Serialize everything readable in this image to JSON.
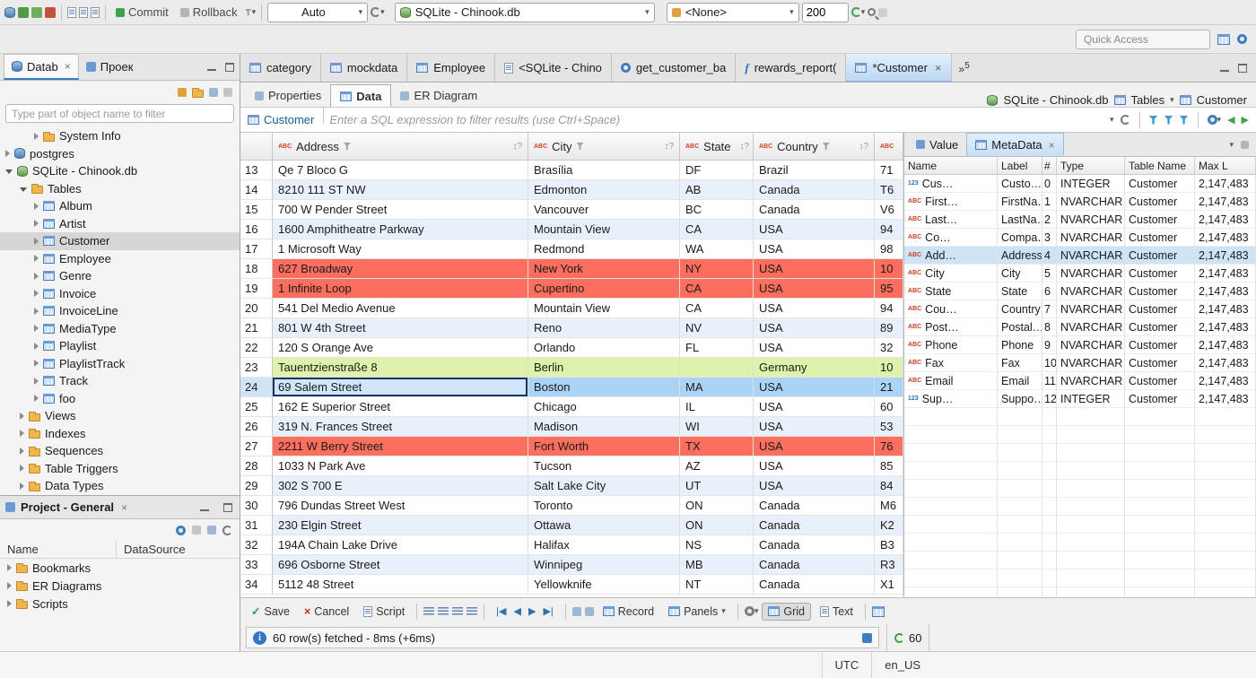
{
  "icons": {
    "close": "×",
    "caret": "▾",
    "overflow_chevrons": "»",
    "sort_hint": "↕?",
    "check": "✓",
    "cancel_x": "×",
    "info": "i",
    "nav_first": "|◀",
    "nav_prev": "◀",
    "nav_next": "▶",
    "nav_last": "▶|",
    "abc": "ABC",
    "num": "123"
  },
  "topbar": {
    "commit": "Commit",
    "rollback": "Rollback",
    "tx_mode": "Auto",
    "datasource": "SQLite - Chinook.db",
    "schema": "<None>",
    "fetch_size": "200",
    "quick_access": "Quick Access"
  },
  "navigator": {
    "tab_database": "Datab",
    "tab_project": "Проек",
    "filter_placeholder": "Type part of object name to filter",
    "tree": [
      {
        "label": "System Info",
        "indent": 2,
        "arrow": "right",
        "icon": "folder"
      },
      {
        "label": "postgres",
        "indent": 0,
        "arrow": "right",
        "icon": "db"
      },
      {
        "label": "SQLite - Chinook.db",
        "indent": 0,
        "arrow": "down",
        "icon": "db-green"
      },
      {
        "label": "Tables",
        "indent": 1,
        "arrow": "down",
        "icon": "folder"
      },
      {
        "label": "Album",
        "indent": 2,
        "arrow": "right",
        "icon": "table"
      },
      {
        "label": "Artist",
        "indent": 2,
        "arrow": "right",
        "icon": "table"
      },
      {
        "label": "Customer",
        "indent": 2,
        "arrow": "right",
        "icon": "table",
        "selected": true
      },
      {
        "label": "Employee",
        "indent": 2,
        "arrow": "right",
        "icon": "table"
      },
      {
        "label": "Genre",
        "indent": 2,
        "arrow": "right",
        "icon": "table"
      },
      {
        "label": "Invoice",
        "indent": 2,
        "arrow": "right",
        "icon": "table"
      },
      {
        "label": "InvoiceLine",
        "indent": 2,
        "arrow": "right",
        "icon": "table"
      },
      {
        "label": "MediaType",
        "indent": 2,
        "arrow": "right",
        "icon": "table"
      },
      {
        "label": "Playlist",
        "indent": 2,
        "arrow": "right",
        "icon": "table"
      },
      {
        "label": "PlaylistTrack",
        "indent": 2,
        "arrow": "right",
        "icon": "table"
      },
      {
        "label": "Track",
        "indent": 2,
        "arrow": "right",
        "icon": "table"
      },
      {
        "label": "foo",
        "indent": 2,
        "arrow": "right",
        "icon": "table"
      },
      {
        "label": "Views",
        "indent": 1,
        "arrow": "right",
        "icon": "folder"
      },
      {
        "label": "Indexes",
        "indent": 1,
        "arrow": "right",
        "icon": "folder"
      },
      {
        "label": "Sequences",
        "indent": 1,
        "arrow": "right",
        "icon": "folder"
      },
      {
        "label": "Table Triggers",
        "indent": 1,
        "arrow": "right",
        "icon": "folder"
      },
      {
        "label": "Data Types",
        "indent": 1,
        "arrow": "right",
        "icon": "folder"
      }
    ]
  },
  "project_panel": {
    "title": "Project - General",
    "col_name": "Name",
    "col_datasource": "DataSource",
    "items": [
      {
        "label": "Bookmarks"
      },
      {
        "label": "ER Diagrams"
      },
      {
        "label": "Scripts"
      }
    ]
  },
  "editor": {
    "tabs": [
      {
        "label": "category",
        "icon": "table"
      },
      {
        "label": "mockdata",
        "icon": "table"
      },
      {
        "label": "Employee",
        "icon": "table"
      },
      {
        "label": "<SQLite - Chino",
        "icon": "sql"
      },
      {
        "label": "get_customer_ba",
        "icon": "proc"
      },
      {
        "label": "rewards_report(",
        "icon": "func"
      },
      {
        "label": "*Customer",
        "icon": "table",
        "active": true
      }
    ],
    "overflow_count": "5",
    "subtabs": [
      {
        "label": "Properties",
        "active": false
      },
      {
        "label": "Data",
        "active": true
      },
      {
        "label": "ER Diagram",
        "active": false
      }
    ],
    "breadcrumb": {
      "datasource": "SQLite - Chinook.db",
      "container": "Tables",
      "entity": "Customer"
    }
  },
  "filterbar": {
    "entity": "Customer",
    "placeholder": "Enter a SQL expression to filter results (use Ctrl+Space)"
  },
  "grid": {
    "columns": [
      {
        "label": "Address",
        "partial": false
      },
      {
        "label": "City",
        "partial": false
      },
      {
        "label": "State",
        "partial": false
      },
      {
        "label": "Country",
        "partial": false
      },
      {
        "label": "",
        "partial": true
      }
    ],
    "rows": [
      {
        "num": "13",
        "bg": "white",
        "cells": [
          "Qe 7 Bloco G",
          "Brasília",
          "DF",
          "Brazil",
          "71"
        ]
      },
      {
        "num": "14",
        "bg": "alt",
        "cells": [
          "8210 111 ST NW",
          "Edmonton",
          "AB",
          "Canada",
          "T6"
        ]
      },
      {
        "num": "15",
        "bg": "white",
        "cells": [
          "700 W Pender Street",
          "Vancouver",
          "BC",
          "Canada",
          "V6"
        ]
      },
      {
        "num": "16",
        "bg": "alt",
        "cells": [
          "1600 Amphitheatre Parkway",
          "Mountain View",
          "CA",
          "USA",
          "94"
        ]
      },
      {
        "num": "17",
        "bg": "white",
        "cells": [
          "1 Microsoft Way",
          "Redmond",
          "WA",
          "USA",
          "98"
        ]
      },
      {
        "num": "18",
        "bg": "red",
        "cells": [
          "627 Broadway",
          "New York",
          "NY",
          "USA",
          "10"
        ]
      },
      {
        "num": "19",
        "bg": "red",
        "cells": [
          "1 Infinite Loop",
          "Cupertino",
          "CA",
          "USA",
          "95"
        ]
      },
      {
        "num": "20",
        "bg": "white",
        "cells": [
          "541 Del Medio Avenue",
          "Mountain View",
          "CA",
          "USA",
          "94"
        ]
      },
      {
        "num": "21",
        "bg": "alt",
        "cells": [
          "801 W 4th Street",
          "Reno",
          "NV",
          "USA",
          "89"
        ]
      },
      {
        "num": "22",
        "bg": "white",
        "cells": [
          "120 S Orange Ave",
          "Orlando",
          "FL",
          "USA",
          "32"
        ]
      },
      {
        "num": "23",
        "bg": "green",
        "cells": [
          "Tauentzienstraße 8",
          "Berlin",
          "",
          "Germany",
          "10"
        ]
      },
      {
        "num": "24",
        "bg": "sel",
        "focus": true,
        "cells": [
          "69 Salem Street",
          "Boston",
          "MA",
          "USA",
          "21"
        ]
      },
      {
        "num": "25",
        "bg": "white",
        "cells": [
          "162 E Superior Street",
          "Chicago",
          "IL",
          "USA",
          "60"
        ]
      },
      {
        "num": "26",
        "bg": "alt",
        "cells": [
          "319 N. Frances Street",
          "Madison",
          "WI",
          "USA",
          "53"
        ]
      },
      {
        "num": "27",
        "bg": "red",
        "cells": [
          "2211 W Berry Street",
          "Fort Worth",
          "TX",
          "USA",
          "76"
        ]
      },
      {
        "num": "28",
        "bg": "white",
        "cells": [
          "1033 N Park Ave",
          "Tucson",
          "AZ",
          "USA",
          "85"
        ]
      },
      {
        "num": "29",
        "bg": "alt",
        "cells": [
          "302 S 700 E",
          "Salt Lake City",
          "UT",
          "USA",
          "84"
        ]
      },
      {
        "num": "30",
        "bg": "white",
        "cells": [
          "796 Dundas Street West",
          "Toronto",
          "ON",
          "Canada",
          "M6"
        ]
      },
      {
        "num": "31",
        "bg": "alt",
        "cells": [
          "230 Elgin Street",
          "Ottawa",
          "ON",
          "Canada",
          "K2"
        ]
      },
      {
        "num": "32",
        "bg": "white",
        "cells": [
          "194A Chain Lake Drive",
          "Halifax",
          "NS",
          "Canada",
          "B3"
        ]
      },
      {
        "num": "33",
        "bg": "alt",
        "cells": [
          "696 Osborne Street",
          "Winnipeg",
          "MB",
          "Canada",
          "R3"
        ]
      },
      {
        "num": "34",
        "bg": "white",
        "cells": [
          "5112 48 Street",
          "Yellowknife",
          "NT",
          "Canada",
          "X1"
        ]
      }
    ]
  },
  "side_panel": {
    "tab_value": "Value",
    "tab_metadata": "MetaData",
    "columns": [
      "Name",
      "Label",
      "#",
      "Type",
      "Table Name",
      "Max L"
    ],
    "rows": [
      {
        "kind": "123",
        "name": "Cus…",
        "label": "Custo…",
        "num": "0",
        "type": "INTEGER",
        "table": "Customer",
        "max": "2,147,483"
      },
      {
        "kind": "abc",
        "name": "First…",
        "label": "FirstNa…",
        "num": "1",
        "type": "NVARCHAR",
        "table": "Customer",
        "max": "2,147,483"
      },
      {
        "kind": "abc",
        "name": "Last…",
        "label": "LastNa…",
        "num": "2",
        "type": "NVARCHAR",
        "table": "Customer",
        "max": "2,147,483"
      },
      {
        "kind": "abc",
        "name": "Co…",
        "label": "Compa…",
        "num": "3",
        "type": "NVARCHAR",
        "table": "Customer",
        "max": "2,147,483"
      },
      {
        "kind": "abc",
        "name": "Add…",
        "label": "Address",
        "num": "4",
        "type": "NVARCHAR",
        "table": "Customer",
        "max": "2,147,483",
        "selected": true
      },
      {
        "kind": "abc",
        "name": "City",
        "label": "City",
        "num": "5",
        "type": "NVARCHAR",
        "table": "Customer",
        "max": "2,147,483"
      },
      {
        "kind": "abc",
        "name": "State",
        "label": "State",
        "num": "6",
        "type": "NVARCHAR",
        "table": "Customer",
        "max": "2,147,483"
      },
      {
        "kind": "abc",
        "name": "Cou…",
        "label": "Country",
        "num": "7",
        "type": "NVARCHAR",
        "table": "Customer",
        "max": "2,147,483"
      },
      {
        "kind": "abc",
        "name": "Post…",
        "label": "Postal…",
        "num": "8",
        "type": "NVARCHAR",
        "table": "Customer",
        "max": "2,147,483"
      },
      {
        "kind": "abc",
        "name": "Phone",
        "label": "Phone",
        "num": "9",
        "type": "NVARCHAR",
        "table": "Customer",
        "max": "2,147,483"
      },
      {
        "kind": "abc",
        "name": "Fax",
        "label": "Fax",
        "num": "10",
        "type": "NVARCHAR",
        "table": "Customer",
        "max": "2,147,483"
      },
      {
        "kind": "abc",
        "name": "Email",
        "label": "Email",
        "num": "11",
        "type": "NVARCHAR",
        "table": "Customer",
        "max": "2,147,483"
      },
      {
        "kind": "123",
        "name": "Sup…",
        "label": "Suppo…",
        "num": "12",
        "type": "INTEGER",
        "table": "Customer",
        "max": "2,147,483"
      }
    ]
  },
  "bottombar": {
    "save": "Save",
    "cancel": "Cancel",
    "script": "Script",
    "record": "Record",
    "panels": "Panels",
    "grid": "Grid",
    "text": "Text"
  },
  "status": {
    "message": "60 row(s) fetched - 8ms (+6ms)",
    "refresh_count": "60"
  },
  "statusbar": {
    "timezone": "UTC",
    "locale": "en_US"
  }
}
